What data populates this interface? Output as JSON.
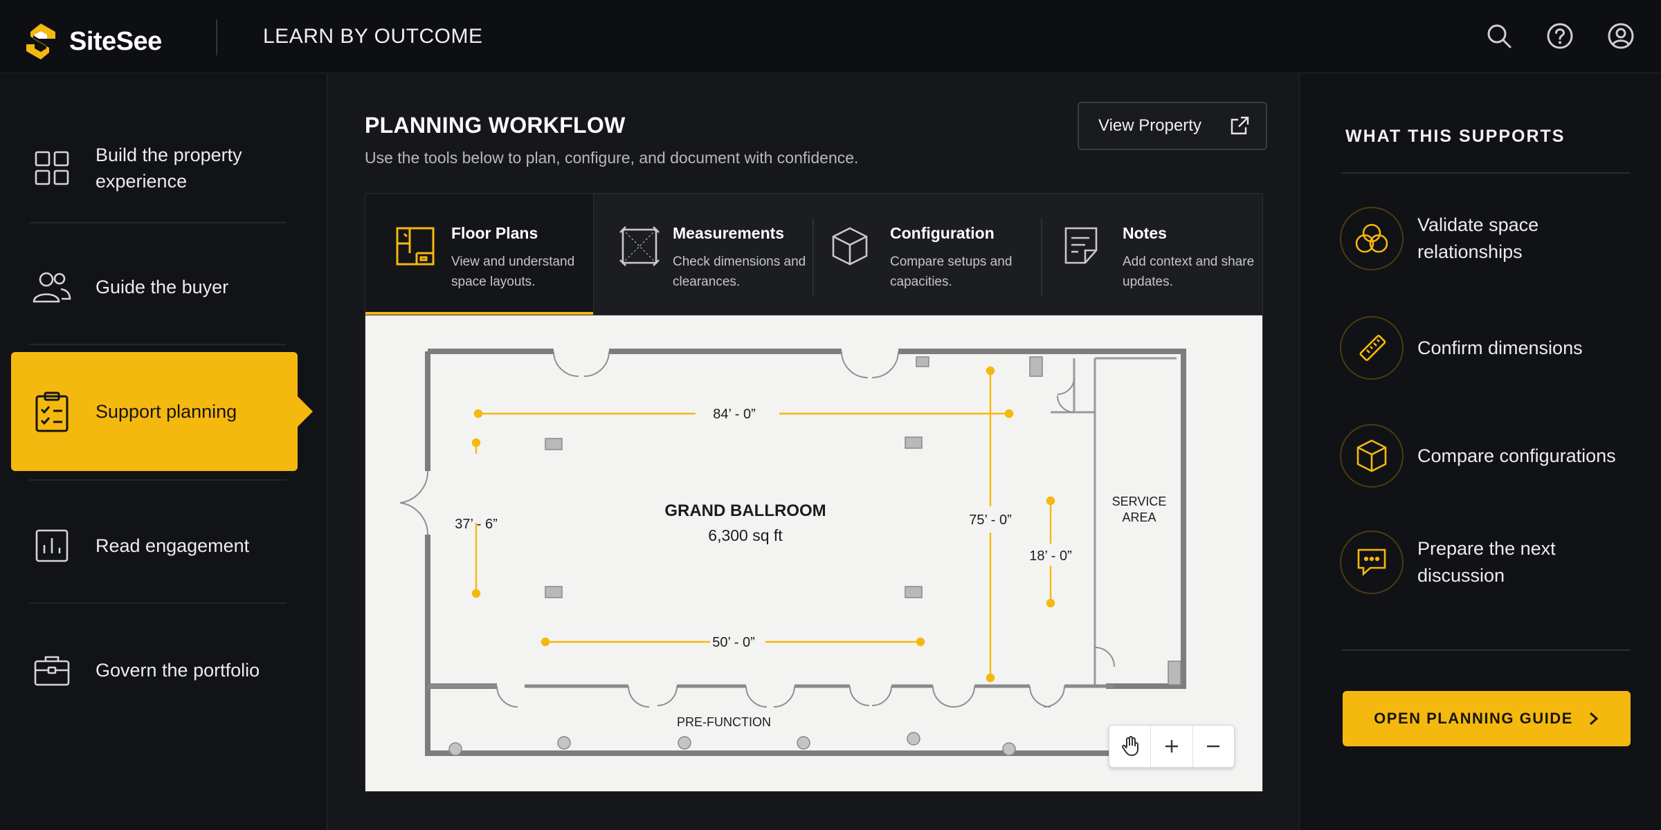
{
  "brand": {
    "name": "SiteSee",
    "accent": "#f5b80f"
  },
  "header": {
    "title": "LEARN BY OUTCOME",
    "icons": [
      "search-icon",
      "help-icon",
      "account-icon"
    ]
  },
  "sidebar": {
    "items": [
      {
        "label": "Build the property experience",
        "icon": "grid-icon",
        "active": false
      },
      {
        "label": "Guide the buyer",
        "icon": "users-icon",
        "active": false
      },
      {
        "label": "Support planning",
        "icon": "clipboard-check-icon",
        "active": true
      },
      {
        "label": "Read engagement",
        "icon": "bar-chart-icon",
        "active": false
      },
      {
        "label": "Govern the portfolio",
        "icon": "briefcase-icon",
        "active": false
      }
    ]
  },
  "main": {
    "title": "PLANNING WORKFLOW",
    "subtitle": "Use the tools below to plan, configure, and document with confidence.",
    "view_button": "View Property",
    "tabs": [
      {
        "title": "Floor Plans",
        "desc": "View and understand space layouts.",
        "icon": "floor-plan-icon",
        "active": true
      },
      {
        "title": "Measurements",
        "desc": "Check dimensions and clearances.",
        "icon": "ruler-frame-icon",
        "active": false
      },
      {
        "title": "Configuration",
        "desc": "Compare setups and capacities.",
        "icon": "cube-icon",
        "active": false
      },
      {
        "title": "Notes",
        "desc": "Add context and share updates.",
        "icon": "note-icon",
        "active": false
      }
    ],
    "floor_plan": {
      "room_name": "GRAND BALLROOM",
      "room_area": "6,300 sq ft",
      "service_area": "SERVICE AREA",
      "pre_function": "PRE-FUNCTION",
      "dimensions": {
        "top": "84’ - 0”",
        "bottom": "50’ - 0”",
        "left": "37’ - 6”",
        "right": "75’ - 0”",
        "service": "18’ - 0”"
      }
    }
  },
  "right_panel": {
    "title": "WHAT THIS SUPPORTS",
    "items": [
      {
        "label": "Validate space relationships",
        "icon": "overlap-circles-icon"
      },
      {
        "label": "Confirm dimensions",
        "icon": "ruler-icon"
      },
      {
        "label": "Compare configurations",
        "icon": "cube-icon"
      },
      {
        "label": "Prepare the next discussion",
        "icon": "chat-icon"
      }
    ],
    "cta": "OPEN PLANNING GUIDE"
  }
}
